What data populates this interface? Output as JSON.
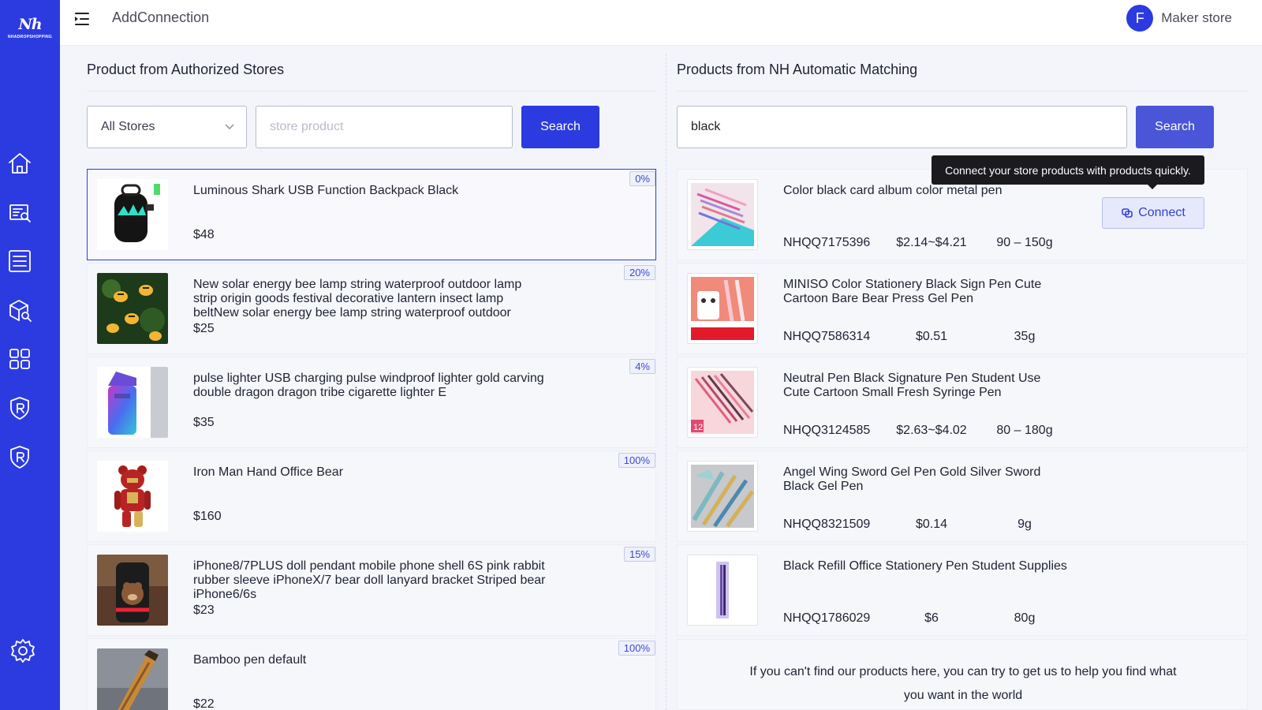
{
  "app": {
    "title": "AddConnection"
  },
  "brand": {
    "logo_mark": "Nh",
    "logo_text": "NHADROPSHOPPING"
  },
  "user": {
    "initial": "F",
    "name": "Maker store"
  },
  "sidebar": {
    "items": [
      {
        "icon": "home-icon"
      },
      {
        "icon": "store-search-icon"
      },
      {
        "icon": "order-list-icon"
      },
      {
        "icon": "product-search-icon"
      },
      {
        "icon": "apps-grid-icon"
      },
      {
        "icon": "shield-r-icon"
      },
      {
        "icon": "shield-r-icon"
      },
      {
        "icon": "settings-gear-icon"
      }
    ]
  },
  "left_panel": {
    "title": "Product from Authorized Stores",
    "store_select": {
      "value": "All Stores"
    },
    "search_input": {
      "value": "",
      "placeholder": "store product"
    },
    "search_label": "Search",
    "products": [
      {
        "name": "Luminous Shark USB Function Backpack Black",
        "price": "$48",
        "match": "0%",
        "selected": true
      },
      {
        "name": "New solar energy bee lamp string waterproof outdoor lamp strip origin goods festival decorative lantern insect lamp beltNew solar energy bee lamp string waterproof outdoor",
        "price": "$25",
        "match": "20%"
      },
      {
        "name": "pulse lighter USB charging pulse windproof lighter gold carving double dragon dragon tribe cigarette lighter E",
        "price": "$35",
        "match": "4%"
      },
      {
        "name": "Iron Man Hand Office Bear",
        "price": "$160",
        "match": "100%"
      },
      {
        "name": "iPhone8/7PLUS doll pendant mobile phone shell 6S pink rabbit rubber sleeve iPhoneX/7 bear doll lanyard bracket Striped bear iPhone6/6s",
        "price": "$23",
        "match": "15%"
      },
      {
        "name": "Bamboo pen default",
        "price": "$22",
        "match": "100%"
      }
    ]
  },
  "right_panel": {
    "title": "Products from NH Automatic Matching",
    "search_input": {
      "value": "black",
      "placeholder": ""
    },
    "search_label": "Search",
    "tooltip": "Connect your store products with products quickly.",
    "connect_label": "Connect",
    "products": [
      {
        "name": "Color black card album color metal pen",
        "sku": "NHQQ7175396",
        "price": "$2.14~$4.21",
        "weight": "90 – 150g"
      },
      {
        "name": "MINISO Color Stationery Black Sign Pen Cute Cartoon Bare Bear Press Gel Pen",
        "sku": "NHQQ7586314",
        "price": "$0.51",
        "weight": "35g"
      },
      {
        "name": "Neutral Pen Black Signature Pen Student Use Cute Cartoon Small Fresh Syringe Pen",
        "sku": "NHQQ3124585",
        "price": "$2.63~$4.02",
        "weight": "80 – 180g"
      },
      {
        "name": "Angel Wing Sword Gel Pen Gold Silver Sword Black Gel Pen",
        "sku": "NHQQ8321509",
        "price": "$0.14",
        "weight": "9g"
      },
      {
        "name": "Black Refill Office Stationery Pen Student Supplies",
        "sku": "NHQQ1786029",
        "price": "$6",
        "weight": "80g"
      }
    ],
    "help_text": "If you can't find our products here, you can try to get us to help you find what you want in the world"
  },
  "colors": {
    "accent": "#2c3be0",
    "badge_text": "#3f4ad0",
    "tooltip_bg": "#1a1a1f"
  }
}
